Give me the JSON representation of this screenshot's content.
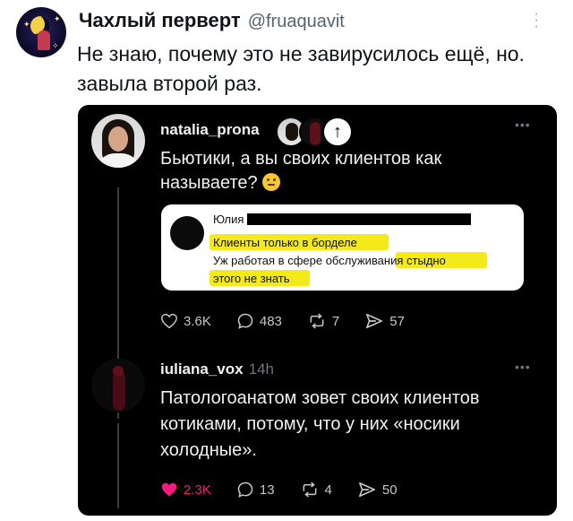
{
  "outer": {
    "display_name": "Чахлый перверт",
    "handle": "@fruaquavit",
    "more_icon": "vertical-dots-icon",
    "text": "Не знаю, почему это не завирусилось ещё, но. завыла второй раз."
  },
  "post1": {
    "username": "natalia_prona",
    "text": "Бьютики, а вы своих клиентов как называете?",
    "emoji": "raised-eyebrow-face",
    "quote": {
      "author": "Юлия",
      "line1": "Клиенты только в борделе",
      "line2a": "Уж работая в сфере обслуживания",
      "line2b": "стыдно",
      "line3": "этого не знать",
      "highlight_color": "#f4ea1a"
    },
    "stats": {
      "likes": "3.6K",
      "replies": "483",
      "reposts": "7",
      "shares": "57"
    }
  },
  "post2": {
    "username": "iuliana_vox",
    "time": "14h",
    "text": "Патологоанатом зовет своих клиентов котиками, потому, что у них «носики холодные».",
    "stats": {
      "likes": "2.3K",
      "replies": "13",
      "reposts": "4",
      "shares": "50"
    },
    "liked": true,
    "like_color": "#f91880"
  }
}
